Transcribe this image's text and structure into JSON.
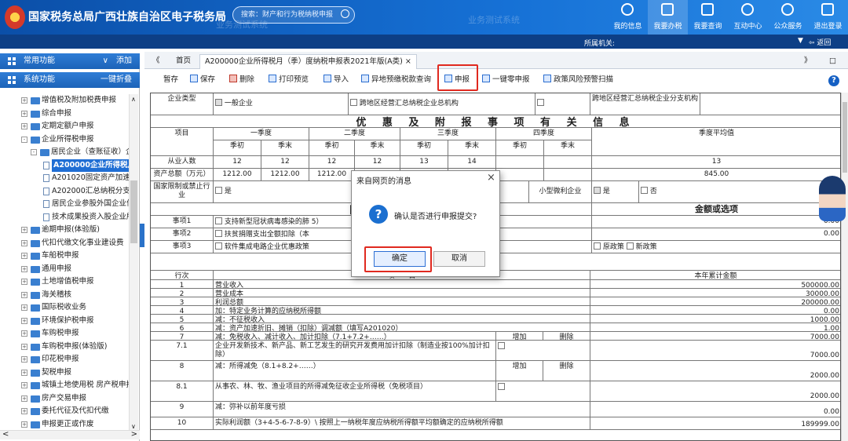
{
  "header": {
    "site_title": "国家税务总局广西壮族自治区电子税务局",
    "search_placeholder": "搜索：财产和行为税纳税申报",
    "watermark": "业务测试系统",
    "nav": [
      {
        "label": "我的信息",
        "icon": "user-icon"
      },
      {
        "label": "我要办税",
        "icon": "monitor-icon"
      },
      {
        "label": "我要查询",
        "icon": "search-doc-icon"
      },
      {
        "label": "互动中心",
        "icon": "chat-icon"
      },
      {
        "label": "公众服务",
        "icon": "shield-icon"
      },
      {
        "label": "退出登录",
        "icon": "logout-icon"
      }
    ]
  },
  "subheader": {
    "org_label": "所属机关:",
    "back_label": "返回"
  },
  "sidebar": {
    "common": "常用功能",
    "common_action": "添加",
    "system": "系统功能",
    "system_action": "一键折叠",
    "items": [
      {
        "label": "增值税及附加税费申报",
        "pm": "+",
        "level": 1
      },
      {
        "label": "综合申报",
        "pm": "+",
        "level": 1
      },
      {
        "label": "定期定额户申报",
        "pm": "+",
        "level": 1
      },
      {
        "label": "企业所得税申报",
        "pm": "-",
        "level": 1
      },
      {
        "label": "居民企业（查账征收）企",
        "pm": "-",
        "level": 2
      },
      {
        "label": "A200000企业所得税月",
        "level": 3,
        "selected": true
      },
      {
        "label": "A201020固定资产加速",
        "level": 3
      },
      {
        "label": "A202000汇总纳税分支",
        "level": 3
      },
      {
        "label": "居民企业参股外国企业信",
        "level": 3
      },
      {
        "label": "技术成果投资入股企业所",
        "level": 3
      },
      {
        "label": "逾期申报(体验版)",
        "pm": "+",
        "level": 1
      },
      {
        "label": "代扣代缴文化事业建设费",
        "pm": "+",
        "level": 1
      },
      {
        "label": "车船税申报",
        "pm": "+",
        "level": 1
      },
      {
        "label": "通用申报",
        "pm": "+",
        "level": 1
      },
      {
        "label": "土地增值税申报",
        "pm": "+",
        "level": 1
      },
      {
        "label": "海关稽核",
        "pm": "+",
        "level": 1
      },
      {
        "label": "国际税收业务",
        "pm": "+",
        "level": 1
      },
      {
        "label": "环境保护税申报",
        "pm": "+",
        "level": 1
      },
      {
        "label": "车购税申报",
        "pm": "+",
        "level": 1
      },
      {
        "label": "车购税申报(体验版)",
        "pm": "+",
        "level": 1
      },
      {
        "label": "印花税申报",
        "pm": "+",
        "level": 1
      },
      {
        "label": "契税申报",
        "pm": "+",
        "level": 1
      },
      {
        "label": "城镇土地使用税 房产税申报",
        "pm": "+",
        "level": 1
      },
      {
        "label": "房产交易申报",
        "pm": "+",
        "level": 1
      },
      {
        "label": "委托代征及代扣代缴",
        "pm": "+",
        "level": 1
      },
      {
        "label": "申报更正或作废",
        "pm": "+",
        "level": 1
      }
    ]
  },
  "tabs": {
    "home": "首页",
    "active_tab": "A200000企业所得税月（季）度纳税申报表2021年版(A类)",
    "close": "×",
    "nav_left": "《",
    "nav_right": "》",
    "window": "□"
  },
  "toolbar": {
    "items": [
      "暂存",
      "保存",
      "删除",
      "打印预览",
      "导入",
      "异地预缴税款查询",
      "申报",
      "一键零申报",
      "政策风险预警扫描"
    ]
  },
  "form": {
    "enterprise_type_label": "企业类型",
    "opt1": "一般企业",
    "opt2": "跨地区经营汇总纳税企业总机构",
    "opt3": "跨地区经营汇总纳税企业分支机构",
    "section1": "优 惠 及 附 报 事 项 有 关 信 息",
    "item": "项目",
    "q1": "一季度",
    "q2": "二季度",
    "q3": "三季度",
    "q4": "四季度",
    "avg": "季度平均值",
    "qstart": "季初",
    "qend": "季末",
    "employees_label": "从业人数",
    "employees": [
      "12",
      "12",
      "12",
      "12",
      "13",
      "14"
    ],
    "employees_avg": "13",
    "assets_label": "资产总额（万元）",
    "assets": [
      "1212.00",
      "1212.00",
      "1212.00"
    ],
    "assets_avg": "845.00",
    "restricted_label": "国家限制或禁止行业",
    "restricted_yes": "是",
    "small_label": "小型微利企业",
    "small_yes": "是",
    "small_no": "否",
    "section2": "附 报",
    "amount_header": "金额或选项",
    "items": [
      {
        "label": "事项1",
        "desc": "支持新型冠状病毒感染的肺",
        "tail": "5）",
        "value": "0.00"
      },
      {
        "label": "事项2",
        "desc": "扶贫捐赠支出全额扣除（本",
        "tail": "",
        "value": "0.00"
      },
      {
        "label": "事项3",
        "desc": "软件集成电路企业优惠政策",
        "tail": "",
        "opt1": "原政策",
        "opt2": "新政策"
      }
    ],
    "line_no": "行次",
    "project": "项　　目",
    "cumulative": "本年累计金额",
    "add": "增加",
    "delete": "删除",
    "rows": [
      {
        "no": "1",
        "desc": "营业收入",
        "value": "500000.00"
      },
      {
        "no": "2",
        "desc": "营业成本",
        "value": "30000.00"
      },
      {
        "no": "3",
        "desc": "利润总额",
        "value": "200000.00"
      },
      {
        "no": "4",
        "desc": "加：特定业务计算的应纳税所得额",
        "value": "0.00"
      },
      {
        "no": "5",
        "desc": "减：不征税收入",
        "value": "1000.00"
      },
      {
        "no": "6",
        "desc": "减：资产加速折旧、摊销（扣除）调减额（填写A201020）",
        "value": "1.00"
      },
      {
        "no": "7",
        "desc": "减：免税收入、减计收入、加计扣除（7.1+7.2+……）",
        "value": "7000.00"
      },
      {
        "no": "7.1",
        "desc": "企业开发新技术、新产品、新工艺发生的研究开发费用加计扣除（制造业按100%加计扣除）",
        "value": "7000.00"
      },
      {
        "no": "8",
        "desc": "减：所得减免（8.1+8.2+……）",
        "value": "2000.00"
      },
      {
        "no": "8.1",
        "desc": "从事农、林、牧、渔业项目的所得减免征收企业所得税（免税项目）",
        "value": "2000.00"
      },
      {
        "no": "9",
        "desc": "减：弥补以前年度亏损",
        "value": "0.00"
      },
      {
        "no": "10",
        "desc": "实际利润额（3+4-5-6-7-8-9）\\ 按照上一纳税年度应纳税所得额平均额确定的应纳税所得额",
        "value": "189999.00"
      }
    ]
  },
  "dialog": {
    "title": "来自网页的消息",
    "close": "×",
    "message": "确认是否进行申报提交?",
    "ok": "确定",
    "cancel": "取消"
  },
  "colors": {
    "header_blue": "#1671d6",
    "highlight_red": "#e0291f",
    "sidebar_blue": "#1f6ed4"
  }
}
